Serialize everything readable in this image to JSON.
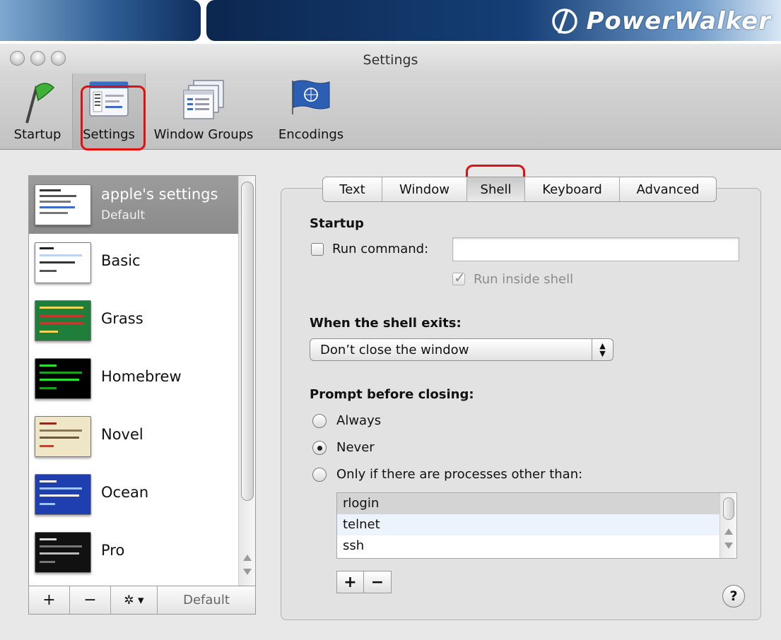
{
  "brand": {
    "name": "PowerWalker"
  },
  "window": {
    "title": "Settings"
  },
  "toolbar": {
    "items": [
      {
        "label": "Startup",
        "icon": "flag-icon"
      },
      {
        "label": "Settings",
        "icon": "settings-profile-icon"
      },
      {
        "label": "Window Groups",
        "icon": "window-groups-icon"
      },
      {
        "label": "Encodings",
        "icon": "un-flag-icon"
      }
    ],
    "selected": "Settings"
  },
  "profiles": [
    {
      "name": "apple's settings",
      "subtitle": "Default",
      "selected": true
    },
    {
      "name": "Basic"
    },
    {
      "name": "Grass"
    },
    {
      "name": "Homebrew"
    },
    {
      "name": "Novel"
    },
    {
      "name": "Ocean"
    },
    {
      "name": "Pro"
    }
  ],
  "list_buttons": {
    "add": "+",
    "remove": "−",
    "gear": "✲ ▾",
    "default": "Default"
  },
  "tabs": [
    {
      "label": "Text"
    },
    {
      "label": "Window"
    },
    {
      "label": "Shell",
      "active": true
    },
    {
      "label": "Keyboard"
    },
    {
      "label": "Advanced"
    }
  ],
  "shell": {
    "startup_heading": "Startup",
    "run_command_label": "Run command:",
    "run_command_value": "",
    "run_inside_shell_label": "Run inside shell",
    "run_inside_shell_checked": true,
    "exit_heading": "When the shell exits:",
    "exit_option": "Don’t close the window",
    "prompt_heading": "Prompt before closing:",
    "radio_always": "Always",
    "radio_never": "Never",
    "radio_only_if": "Only if there are processes other than:",
    "selected_radio": "Never",
    "processes": [
      "rlogin",
      "telnet",
      "ssh"
    ],
    "add_label": "+",
    "remove_label": "−",
    "help_label": "?"
  },
  "colors": {
    "highlight_marker": "#e01010",
    "brand_blue": "#153f76"
  }
}
